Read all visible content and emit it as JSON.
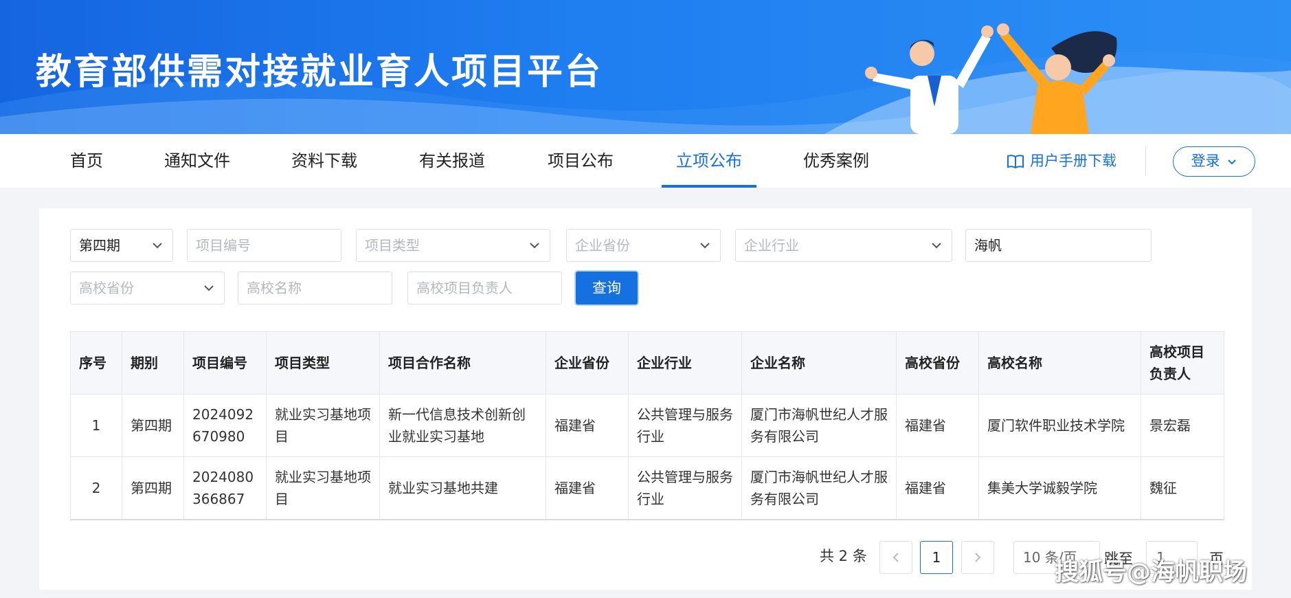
{
  "banner": {
    "title": "教育部供需对接就业育人项目平台"
  },
  "nav": {
    "items": [
      {
        "label": "首页"
      },
      {
        "label": "通知文件"
      },
      {
        "label": "资料下载"
      },
      {
        "label": "有关报道"
      },
      {
        "label": "项目公布"
      },
      {
        "label": "立项公布"
      },
      {
        "label": "优秀案例"
      }
    ],
    "active": "立项公布",
    "manual": "用户手册下载",
    "login": "登录"
  },
  "filters": {
    "period": "第四期",
    "project_no_ph": "项目编号",
    "project_type_ph": "项目类型",
    "company_province_ph": "企业省份",
    "company_industry_ph": "企业行业",
    "company_name": "海帆",
    "school_province_ph": "高校省份",
    "school_name_ph": "高校名称",
    "school_leader_ph": "高校项目负责人",
    "query": "查询"
  },
  "table": {
    "headers": [
      "序号",
      "期别",
      "项目编号",
      "项目类型",
      "项目合作名称",
      "企业省份",
      "企业行业",
      "企业名称",
      "高校省份",
      "高校名称",
      "高校项目负责人"
    ],
    "rows": [
      [
        "1",
        "第四期",
        "2024092670980",
        "就业实习基地项目",
        "新一代信息技术创新创业就业实习基地",
        "福建省",
        "公共管理与服务行业",
        "厦门市海帆世纪人才服务有限公司",
        "福建省",
        "厦门软件职业技术学院",
        "景宏磊"
      ],
      [
        "2",
        "第四期",
        "2024080366867",
        "就业实习基地项目",
        "就业实习基地共建",
        "福建省",
        "公共管理与服务行业",
        "厦门市海帆世纪人才服务有限公司",
        "福建省",
        "集美大学诚毅学院",
        "魏征"
      ]
    ]
  },
  "pagination": {
    "total": "共 2 条",
    "current": "1",
    "page_size": "10 条/页",
    "jump_label": "跳至",
    "jump_value": "1",
    "page_suffix": "页"
  },
  "watermark": "搜狐号@海帆职场",
  "colors": {
    "primary": "#1570e0",
    "banner": "#1f7ef0"
  },
  "icons": {
    "manual": "book-open-icon",
    "chevron": "chevron-down-icon",
    "prev": "chevron-left-icon",
    "next": "chevron-right-icon"
  }
}
